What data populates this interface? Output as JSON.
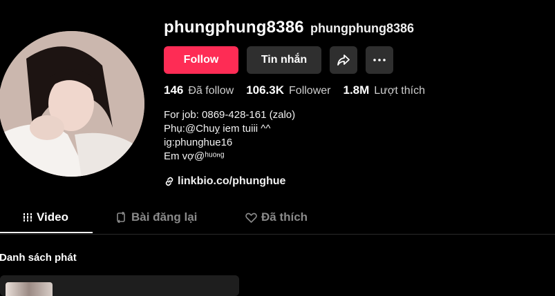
{
  "profile": {
    "username": "phungphung8386",
    "nickname": "phungphung8386"
  },
  "actions": {
    "follow_label": "Follow",
    "message_label": "Tin nhắn"
  },
  "stats": [
    {
      "value": "146",
      "label": "Đã follow"
    },
    {
      "value": "106.3K",
      "label": "Follower"
    },
    {
      "value": "1.8M",
      "label": "Lượt thích"
    }
  ],
  "bio": {
    "lines": [
      "For job: 0869-428-161 (zalo)",
      "Phụ:@Chuỵ iem tuiii ^^",
      "ig:phunghue16",
      "Em vợ@ʰᵘᵒⁿᵍ"
    ],
    "link": "linkbio.co/phunghue"
  },
  "tabs": [
    {
      "label": "Video",
      "active": true
    },
    {
      "label": "Bài đăng lại",
      "active": false
    },
    {
      "label": "Đã thích",
      "active": false
    }
  ],
  "playlists": {
    "title": "Danh sách phát"
  },
  "colors": {
    "accent": "#fe2c55",
    "background": "#000000",
    "button_secondary": "#2f2f2f"
  }
}
